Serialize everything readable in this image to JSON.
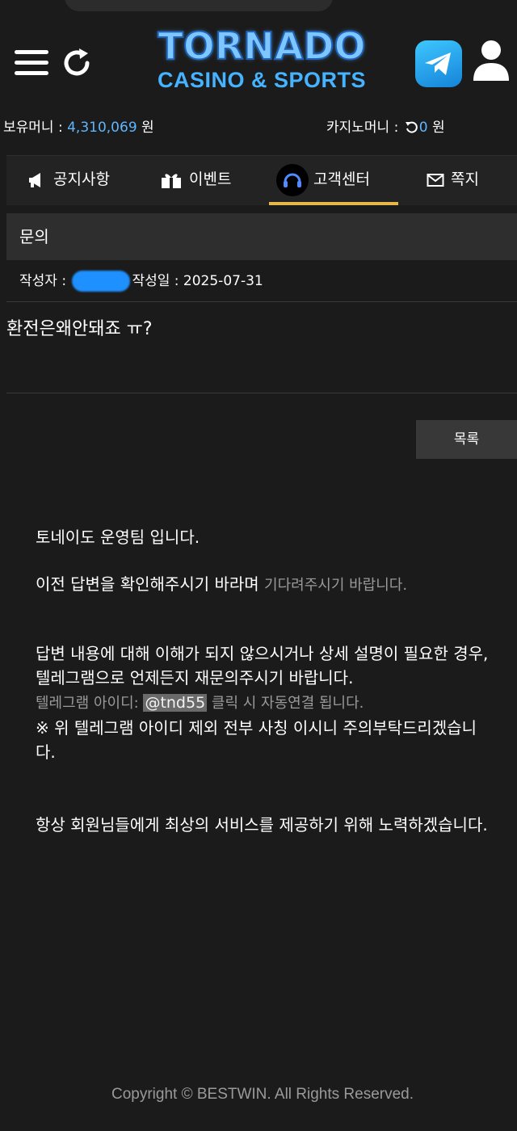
{
  "header": {
    "logo_main": "TORNADO",
    "logo_sub": "CASINO & SPORTS"
  },
  "balance": {
    "holding_label": "보유머니 : ",
    "holding_value": "4,310,069",
    "holding_unit": " 원",
    "casino_label": "카지노머니 : ",
    "casino_value": "0",
    "casino_unit": " 원"
  },
  "tabs": [
    {
      "label": "공지사항",
      "icon": "megaphone-icon"
    },
    {
      "label": "이벤트",
      "icon": "gift-icon"
    },
    {
      "label": "고객센터",
      "icon": "headset-icon",
      "active": true
    },
    {
      "label": "쪽지",
      "icon": "envelope-icon"
    }
  ],
  "post": {
    "section_title": "문의",
    "author_label": "작성자 : ",
    "date_label": "작성일 : 2025-07-31",
    "question": "환전은왜안돼죠 ㅠ?",
    "list_button": "목록"
  },
  "answer": {
    "line1": "토네이도 운영팀 입니다.",
    "line2_main": "이전 답변을 확인해주시기 바라며 ",
    "line2_dim": "기다려주시기 바랍니다.",
    "line3": "답변 내용에 대해 이해가 되지 않으시거나 상세 설명이 필요한 경우,",
    "line4": "텔레그램으로  언제든지 재문의주시기 바랍니다.",
    "line5_dim_a": "텔레그램 아이디: ",
    "telegram_id": "@tnd55",
    "line5_dim_b": " 클릭 시 자동연결 됩니다.",
    "line6": "※ 위 텔레그램 아이디 제외 전부 사칭 이시니 주의부탁드리겠습니다.",
    "line7": "항상 회원님들에게 최상의 서비스를 제공하기 위해 노력하겠습니다."
  },
  "footer": {
    "copyright": "Copyright © BESTWIN. All Rights Reserved."
  },
  "colors": {
    "background": "#1b1b1b",
    "accent_blue": "#5fb6ff",
    "active_tab_underline": "#e8b74a"
  }
}
